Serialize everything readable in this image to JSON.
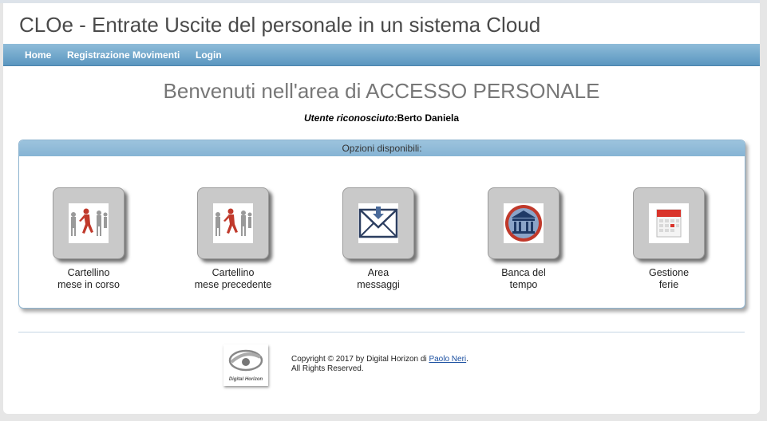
{
  "header": {
    "title": "CLOe - Entrate Uscite del personale in un sistema Cloud"
  },
  "nav": {
    "items": [
      {
        "label": "Home"
      },
      {
        "label": "Registrazione Movimenti"
      },
      {
        "label": "Login"
      }
    ]
  },
  "main": {
    "welcome": "Benvenuti nell'area di ACCESSO PERSONALE",
    "user_label": "Utente riconosciuto:",
    "user_name": "Berto Daniela",
    "options_title": "Opzioni disponibili:",
    "options": [
      {
        "line1": "Cartellino",
        "line2": "mese in corso",
        "icon": "running-people-icon"
      },
      {
        "line1": "Cartellino",
        "line2": "mese precedente",
        "icon": "running-people-icon"
      },
      {
        "line1": "Area",
        "line2": "messaggi",
        "icon": "envelope-icon"
      },
      {
        "line1": "Banca del",
        "line2": "tempo",
        "icon": "time-bank-icon"
      },
      {
        "line1": "Gestione",
        "line2": "ferie",
        "icon": "calendar-icon"
      }
    ]
  },
  "footer": {
    "logo_text": "Digital Horizon",
    "copyright_prefix": "Copyright © 2017 by Digital Horizon di ",
    "author_link": "Paolo Neri",
    "copyright_suffix": ".",
    "rights": "All Rights Reserved."
  },
  "colors": {
    "navbar": "#6fa6cc",
    "panel_header": "#8fbbd8",
    "accent_red": "#c0392b"
  }
}
